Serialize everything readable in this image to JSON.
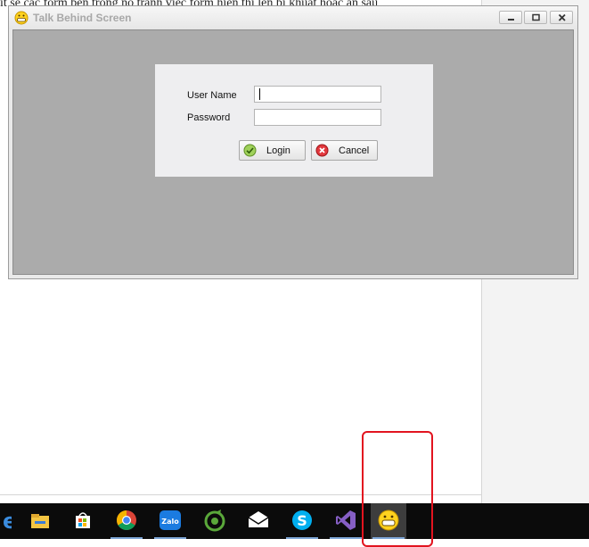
{
  "background": {
    "article_text": "ít sẽ các form bên trong nó tránh việc form hiện thị lên bị khuất hoặc ẩn sau"
  },
  "window": {
    "title": "Talk Behind Screen",
    "controls": [
      "minimize-icon",
      "maximize-icon",
      "close-icon"
    ]
  },
  "login": {
    "username_label": "User Name",
    "username_value": "",
    "password_label": "Password",
    "password_value": "",
    "login_button": "Login",
    "cancel_button": "Cancel"
  },
  "taskbar": {
    "items": [
      "edge-icon",
      "file-explorer-icon",
      "store-icon",
      "chrome-icon",
      "zalo-icon",
      "coccoc-icon",
      "mail-icon",
      "skype-icon",
      "visual-studio-icon",
      "smiley-app-icon"
    ],
    "zalo_label": "Zalo"
  },
  "colors": {
    "client_area": "#ababab",
    "panel": "#eeeef0",
    "taskbar": "#0b0b0b",
    "highlight_box": "#e2141f"
  }
}
